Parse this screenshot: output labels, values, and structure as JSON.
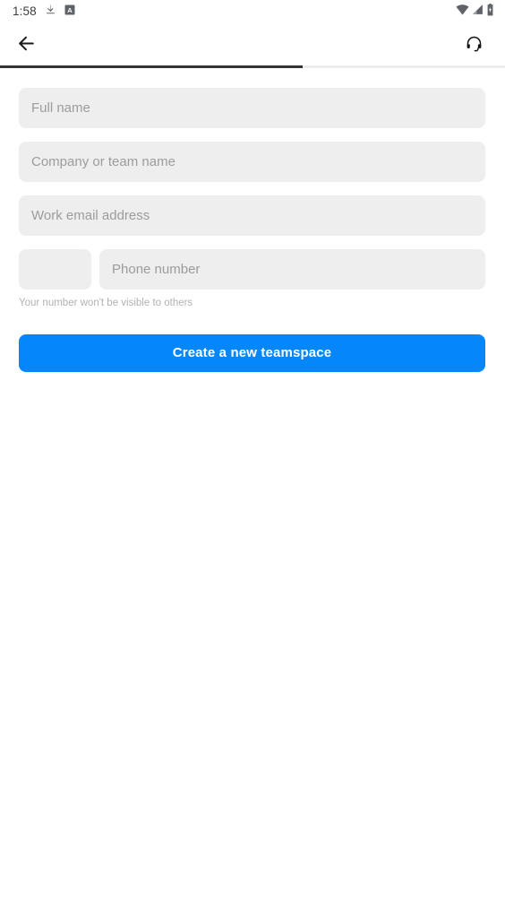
{
  "status_bar": {
    "time": "1:58",
    "left_icons": [
      {
        "name": "download-icon"
      },
      {
        "name": "app-badge-a-icon",
        "glyph": "A"
      }
    ],
    "right_icons": [
      {
        "name": "wifi-icon"
      },
      {
        "name": "cellular-signal-icon"
      },
      {
        "name": "battery-icon"
      }
    ]
  },
  "app_bar": {
    "back_label": "Back",
    "support_label": "Support"
  },
  "progress": {
    "percent": 60
  },
  "form": {
    "fields": [
      {
        "name": "full-name",
        "placeholder": "Full name",
        "value": ""
      },
      {
        "name": "company-name",
        "placeholder": "Company or team name",
        "value": ""
      },
      {
        "name": "work-email",
        "placeholder": "Work email address",
        "value": ""
      }
    ],
    "country_code": {
      "placeholder": "",
      "value": ""
    },
    "phone": {
      "placeholder": "Phone number",
      "value": ""
    },
    "helper_text": "Your number won't be visible to others",
    "submit_label": "Create a new teamspace"
  },
  "colors": {
    "accent": "#0587fb",
    "field_bg": "#eeeeee",
    "placeholder": "#9c9c9c",
    "progress_fill": "#333333",
    "progress_track": "#ececec"
  }
}
